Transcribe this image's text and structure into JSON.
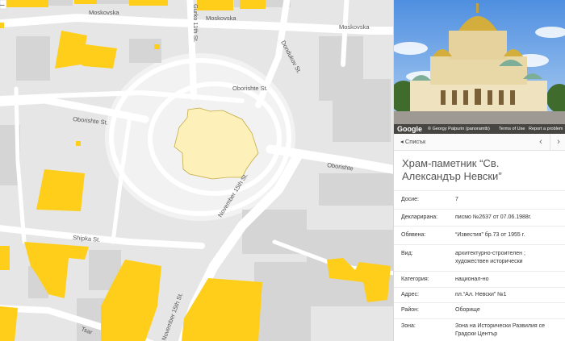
{
  "map": {
    "colors": {
      "background": "#e6e6e6",
      "road": "#ffffff",
      "plaza": "#f2f2f2",
      "building_grey": "#d5d5d5",
      "heritage_building": "#fece1b",
      "selected_building": "#fdf0b9"
    },
    "streets": [
      "Moskovska",
      "Moskovska",
      "Moskovska",
      "Gurko 11th St.",
      "Dondukov St.",
      "Oborishte St.",
      "Oborishte St.",
      "Oborishte",
      "November 15th St.",
      "Shipka St.",
      "November 15th St.",
      "Tsar"
    ],
    "zoom_out_symbol": "–"
  },
  "panel": {
    "photo": {
      "google_logo": "Google",
      "credit": "© Georgy Palpurin (panoramtb)",
      "terms": "Terms of Use",
      "report": "Report a problem"
    },
    "nav": {
      "back_label": "◂ Списък",
      "prev_symbol": "‹",
      "next_symbol": "›"
    },
    "title": "Храм-паметник “Св. Александър Невски”",
    "rows": [
      {
        "label": "Досие:",
        "value": "7"
      },
      {
        "label": "Декларирана:",
        "value": "писмо №2637 от 07.06.1988г."
      },
      {
        "label": "Обявена:",
        "value": "“Известия” бр.73 от 1955 г."
      },
      {
        "label": "Вид:",
        "value": "архитектурно-строителен ; художествен исторически"
      },
      {
        "label": "Категория:",
        "value": "национал-но"
      },
      {
        "label": "Адрес:",
        "value": "пл.“Ал. Невски” №1"
      },
      {
        "label": "Район:",
        "value": "Оборище"
      },
      {
        "label": "Зона:",
        "value": "Зона на Исторически Развилия се Градски Център"
      }
    ]
  }
}
